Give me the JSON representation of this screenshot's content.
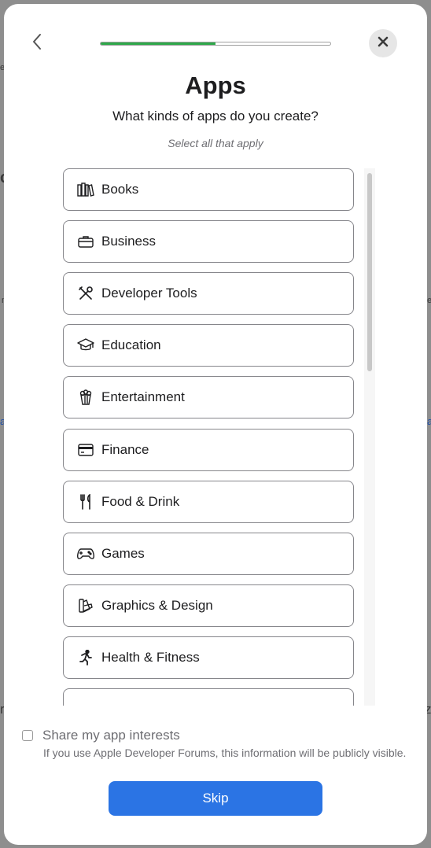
{
  "modal": {
    "title": "Apps",
    "subtitle": "What kinds of apps do you create?",
    "hint": "Select all that apply",
    "progress_fraction": 0.5,
    "accent_color": "#2ea84a",
    "primary_color": "#2b74e4"
  },
  "options": [
    {
      "label": "Books",
      "icon": "books-icon"
    },
    {
      "label": "Business",
      "icon": "briefcase-icon"
    },
    {
      "label": "Developer Tools",
      "icon": "tools-icon"
    },
    {
      "label": "Education",
      "icon": "graduation-cap-icon"
    },
    {
      "label": "Entertainment",
      "icon": "popcorn-icon"
    },
    {
      "label": "Finance",
      "icon": "credit-card-icon"
    },
    {
      "label": "Food & Drink",
      "icon": "fork-knife-icon"
    },
    {
      "label": "Games",
      "icon": "game-controller-icon"
    },
    {
      "label": "Graphics & Design",
      "icon": "paintbrush-icon"
    },
    {
      "label": "Health & Fitness",
      "icon": "running-figure-icon"
    },
    {
      "label": "",
      "icon": "partial-icon"
    }
  ],
  "share": {
    "label": "Share my app interests",
    "note": "If you use Apple Developer Forums, this information will be publicly visible.",
    "checked": false
  },
  "skip_label": "Skip"
}
